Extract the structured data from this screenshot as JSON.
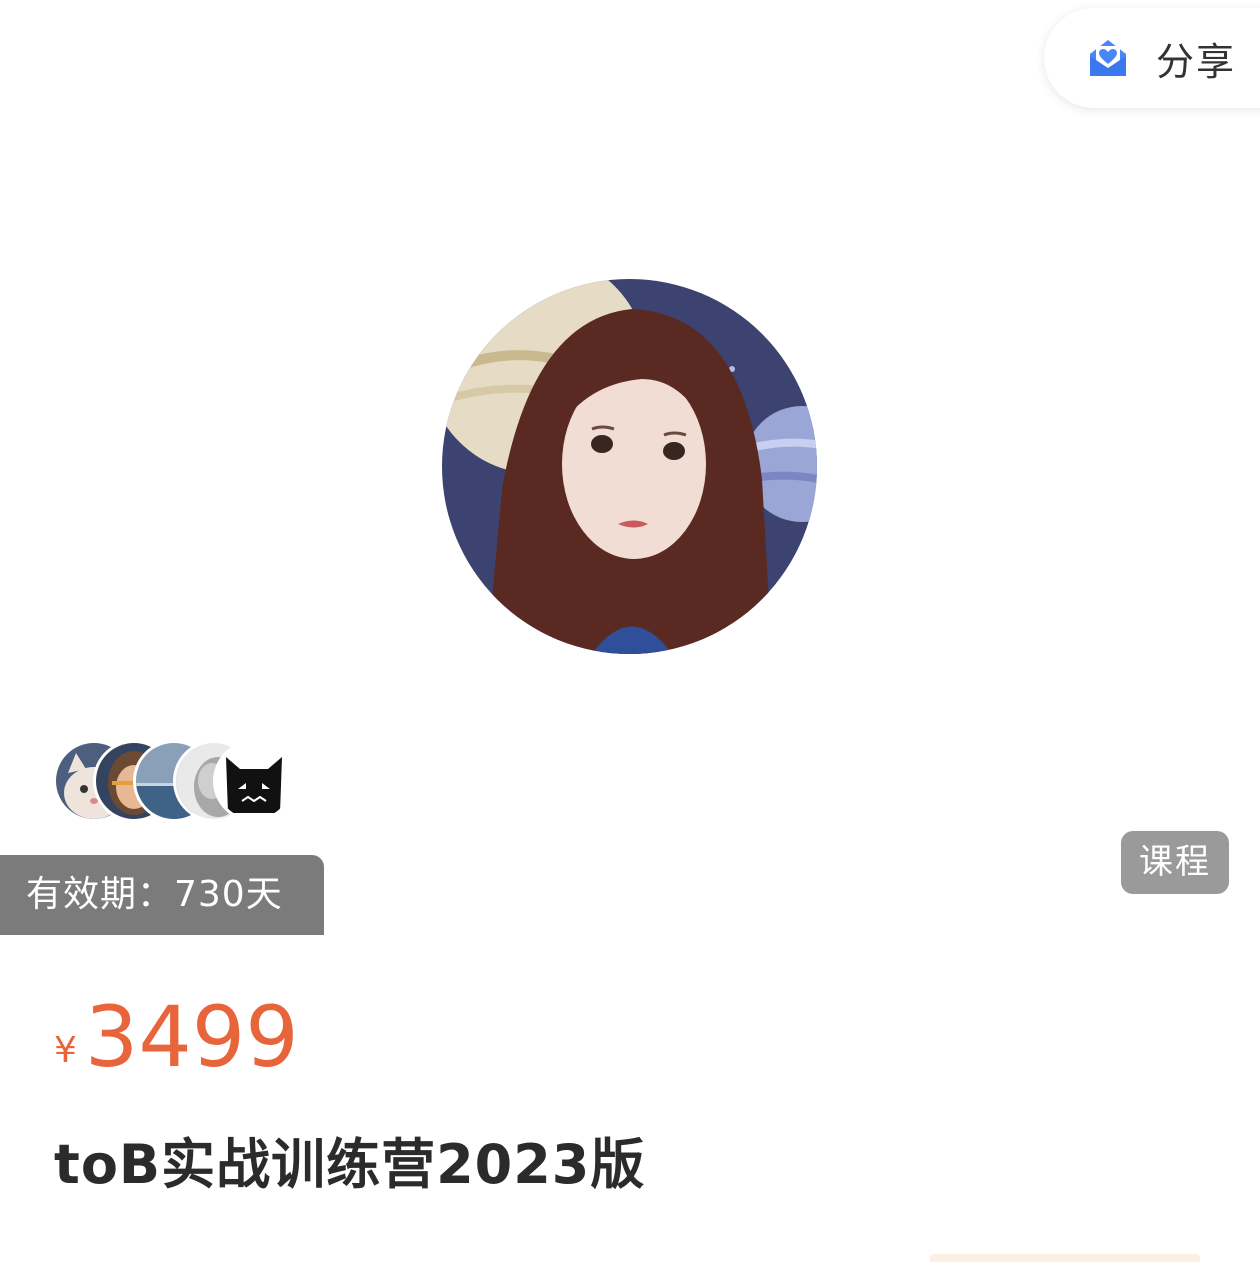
{
  "share": {
    "label": "分享",
    "icon": "heart-envelope-icon",
    "icon_color": "#4a86f7"
  },
  "hero": {
    "avatar": "illustrated-woman-avatar"
  },
  "learners": {
    "avatars": [
      "cat-avatar",
      "photo-avatar-girl",
      "photo-avatar-sea",
      "photo-avatar-face",
      "black-cat-avatar"
    ]
  },
  "validity": {
    "text": "有效期：730天"
  },
  "badge": {
    "label": "课程"
  },
  "price": {
    "currency": "¥",
    "amount": "3499",
    "color": "#e8653c"
  },
  "course": {
    "title": "toB实战训练营2023版"
  }
}
